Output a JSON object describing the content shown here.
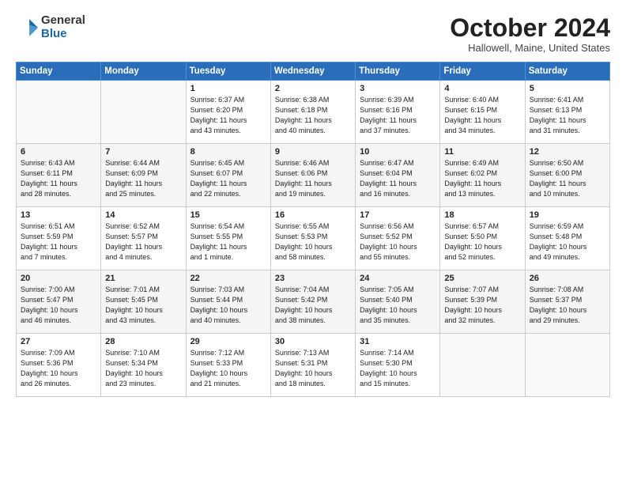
{
  "header": {
    "logo_general": "General",
    "logo_blue": "Blue",
    "month_title": "October 2024",
    "location": "Hallowell, Maine, United States"
  },
  "days_of_week": [
    "Sunday",
    "Monday",
    "Tuesday",
    "Wednesday",
    "Thursday",
    "Friday",
    "Saturday"
  ],
  "weeks": [
    [
      {
        "day": "",
        "info": ""
      },
      {
        "day": "",
        "info": ""
      },
      {
        "day": "1",
        "info": "Sunrise: 6:37 AM\nSunset: 6:20 PM\nDaylight: 11 hours\nand 43 minutes."
      },
      {
        "day": "2",
        "info": "Sunrise: 6:38 AM\nSunset: 6:18 PM\nDaylight: 11 hours\nand 40 minutes."
      },
      {
        "day": "3",
        "info": "Sunrise: 6:39 AM\nSunset: 6:16 PM\nDaylight: 11 hours\nand 37 minutes."
      },
      {
        "day": "4",
        "info": "Sunrise: 6:40 AM\nSunset: 6:15 PM\nDaylight: 11 hours\nand 34 minutes."
      },
      {
        "day": "5",
        "info": "Sunrise: 6:41 AM\nSunset: 6:13 PM\nDaylight: 11 hours\nand 31 minutes."
      }
    ],
    [
      {
        "day": "6",
        "info": "Sunrise: 6:43 AM\nSunset: 6:11 PM\nDaylight: 11 hours\nand 28 minutes."
      },
      {
        "day": "7",
        "info": "Sunrise: 6:44 AM\nSunset: 6:09 PM\nDaylight: 11 hours\nand 25 minutes."
      },
      {
        "day": "8",
        "info": "Sunrise: 6:45 AM\nSunset: 6:07 PM\nDaylight: 11 hours\nand 22 minutes."
      },
      {
        "day": "9",
        "info": "Sunrise: 6:46 AM\nSunset: 6:06 PM\nDaylight: 11 hours\nand 19 minutes."
      },
      {
        "day": "10",
        "info": "Sunrise: 6:47 AM\nSunset: 6:04 PM\nDaylight: 11 hours\nand 16 minutes."
      },
      {
        "day": "11",
        "info": "Sunrise: 6:49 AM\nSunset: 6:02 PM\nDaylight: 11 hours\nand 13 minutes."
      },
      {
        "day": "12",
        "info": "Sunrise: 6:50 AM\nSunset: 6:00 PM\nDaylight: 11 hours\nand 10 minutes."
      }
    ],
    [
      {
        "day": "13",
        "info": "Sunrise: 6:51 AM\nSunset: 5:59 PM\nDaylight: 11 hours\nand 7 minutes."
      },
      {
        "day": "14",
        "info": "Sunrise: 6:52 AM\nSunset: 5:57 PM\nDaylight: 11 hours\nand 4 minutes."
      },
      {
        "day": "15",
        "info": "Sunrise: 6:54 AM\nSunset: 5:55 PM\nDaylight: 11 hours\nand 1 minute."
      },
      {
        "day": "16",
        "info": "Sunrise: 6:55 AM\nSunset: 5:53 PM\nDaylight: 10 hours\nand 58 minutes."
      },
      {
        "day": "17",
        "info": "Sunrise: 6:56 AM\nSunset: 5:52 PM\nDaylight: 10 hours\nand 55 minutes."
      },
      {
        "day": "18",
        "info": "Sunrise: 6:57 AM\nSunset: 5:50 PM\nDaylight: 10 hours\nand 52 minutes."
      },
      {
        "day": "19",
        "info": "Sunrise: 6:59 AM\nSunset: 5:48 PM\nDaylight: 10 hours\nand 49 minutes."
      }
    ],
    [
      {
        "day": "20",
        "info": "Sunrise: 7:00 AM\nSunset: 5:47 PM\nDaylight: 10 hours\nand 46 minutes."
      },
      {
        "day": "21",
        "info": "Sunrise: 7:01 AM\nSunset: 5:45 PM\nDaylight: 10 hours\nand 43 minutes."
      },
      {
        "day": "22",
        "info": "Sunrise: 7:03 AM\nSunset: 5:44 PM\nDaylight: 10 hours\nand 40 minutes."
      },
      {
        "day": "23",
        "info": "Sunrise: 7:04 AM\nSunset: 5:42 PM\nDaylight: 10 hours\nand 38 minutes."
      },
      {
        "day": "24",
        "info": "Sunrise: 7:05 AM\nSunset: 5:40 PM\nDaylight: 10 hours\nand 35 minutes."
      },
      {
        "day": "25",
        "info": "Sunrise: 7:07 AM\nSunset: 5:39 PM\nDaylight: 10 hours\nand 32 minutes."
      },
      {
        "day": "26",
        "info": "Sunrise: 7:08 AM\nSunset: 5:37 PM\nDaylight: 10 hours\nand 29 minutes."
      }
    ],
    [
      {
        "day": "27",
        "info": "Sunrise: 7:09 AM\nSunset: 5:36 PM\nDaylight: 10 hours\nand 26 minutes."
      },
      {
        "day": "28",
        "info": "Sunrise: 7:10 AM\nSunset: 5:34 PM\nDaylight: 10 hours\nand 23 minutes."
      },
      {
        "day": "29",
        "info": "Sunrise: 7:12 AM\nSunset: 5:33 PM\nDaylight: 10 hours\nand 21 minutes."
      },
      {
        "day": "30",
        "info": "Sunrise: 7:13 AM\nSunset: 5:31 PM\nDaylight: 10 hours\nand 18 minutes."
      },
      {
        "day": "31",
        "info": "Sunrise: 7:14 AM\nSunset: 5:30 PM\nDaylight: 10 hours\nand 15 minutes."
      },
      {
        "day": "",
        "info": ""
      },
      {
        "day": "",
        "info": ""
      }
    ]
  ]
}
